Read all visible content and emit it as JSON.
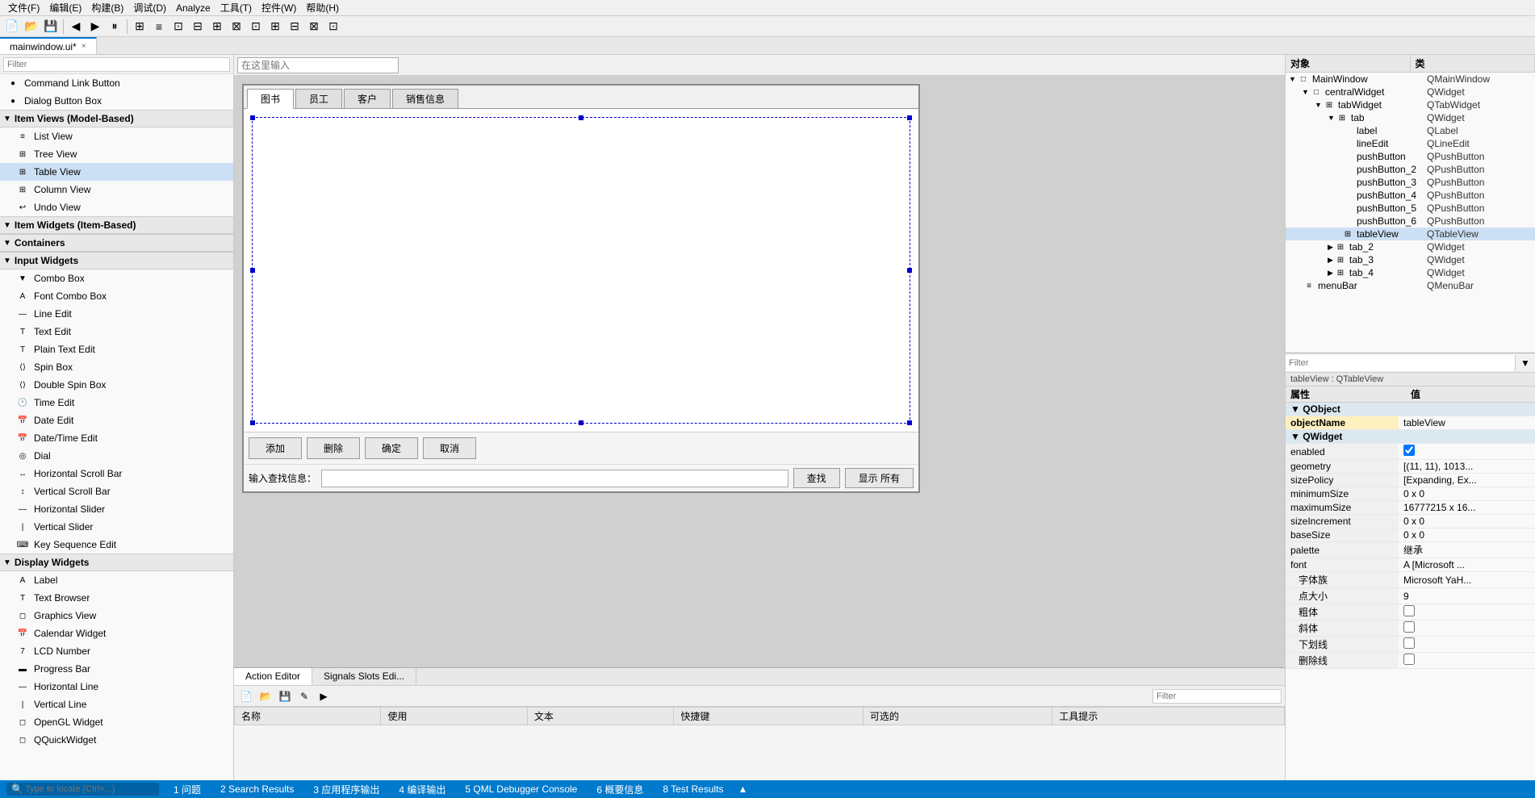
{
  "menubar": {
    "items": [
      "文件(F)",
      "编辑(E)",
      "构建(B)",
      "调试(D)",
      "Analyze",
      "工具(T)",
      "控件(W)",
      "帮助(H)"
    ]
  },
  "filetab": {
    "name": "mainwindow.ui*",
    "close": "×"
  },
  "sidebar": {
    "filter_placeholder": "Filter",
    "items": [
      {
        "id": "command-link-button",
        "label": "Command Link Button",
        "indent": 0,
        "icon": "●"
      },
      {
        "id": "dialog-button-box",
        "label": "Dialog Button Box",
        "indent": 0,
        "icon": "●"
      },
      {
        "id": "item-views-header",
        "label": "Item Views (Model-Based)",
        "indent": 0,
        "type": "category"
      },
      {
        "id": "list-view",
        "label": "List View",
        "indent": 1,
        "icon": "≡"
      },
      {
        "id": "tree-view",
        "label": "Tree View",
        "indent": 1,
        "icon": "⊞"
      },
      {
        "id": "table-view",
        "label": "Table View",
        "indent": 1,
        "icon": "⊞",
        "selected": true
      },
      {
        "id": "column-view",
        "label": "Column View",
        "indent": 1,
        "icon": "⊞"
      },
      {
        "id": "undo-view",
        "label": "Undo View",
        "indent": 1,
        "icon": "↩"
      },
      {
        "id": "item-widgets-header",
        "label": "Item Widgets (Item-Based)",
        "indent": 0,
        "type": "category"
      },
      {
        "id": "containers-header",
        "label": "Containers",
        "indent": 0,
        "type": "category"
      },
      {
        "id": "input-widgets-header",
        "label": "Input Widgets",
        "indent": 0,
        "type": "category"
      },
      {
        "id": "combo-box",
        "label": "Combo Box",
        "indent": 1,
        "icon": "▼"
      },
      {
        "id": "font-combo-box",
        "label": "Font Combo Box",
        "indent": 1,
        "icon": "A"
      },
      {
        "id": "line-edit",
        "label": "Line Edit",
        "indent": 1,
        "icon": "—"
      },
      {
        "id": "text-edit",
        "label": "Text Edit",
        "indent": 1,
        "icon": "T"
      },
      {
        "id": "plain-text-edit",
        "label": "Plain Text Edit",
        "indent": 1,
        "icon": "T"
      },
      {
        "id": "spin-box",
        "label": "Spin Box",
        "indent": 1,
        "icon": "⟨⟩"
      },
      {
        "id": "double-spin-box",
        "label": "Double Spin Box",
        "indent": 1,
        "icon": "⟨⟩"
      },
      {
        "id": "time-edit",
        "label": "Time Edit",
        "indent": 1,
        "icon": "🕐"
      },
      {
        "id": "date-edit",
        "label": "Date Edit",
        "indent": 1,
        "icon": "📅"
      },
      {
        "id": "datetime-edit",
        "label": "Date/Time Edit",
        "indent": 1,
        "icon": "📅"
      },
      {
        "id": "dial",
        "label": "Dial",
        "indent": 1,
        "icon": "◎"
      },
      {
        "id": "horizontal-scroll-bar",
        "label": "Horizontal Scroll Bar",
        "indent": 1,
        "icon": "↔"
      },
      {
        "id": "vertical-scroll-bar",
        "label": "Vertical Scroll Bar",
        "indent": 1,
        "icon": "↕"
      },
      {
        "id": "horizontal-slider",
        "label": "Horizontal Slider",
        "indent": 1,
        "icon": "—"
      },
      {
        "id": "vertical-slider",
        "label": "Vertical Slider",
        "indent": 1,
        "icon": "|"
      },
      {
        "id": "key-sequence-edit",
        "label": "Key Sequence Edit",
        "indent": 1,
        "icon": "⌨"
      },
      {
        "id": "display-widgets-header",
        "label": "Display Widgets",
        "indent": 0,
        "type": "category"
      },
      {
        "id": "label",
        "label": "Label",
        "indent": 1,
        "icon": "A"
      },
      {
        "id": "text-browser",
        "label": "Text Browser",
        "indent": 1,
        "icon": "T"
      },
      {
        "id": "graphics-view",
        "label": "Graphics View",
        "indent": 1,
        "icon": "◻"
      },
      {
        "id": "calendar-widget",
        "label": "Calendar Widget",
        "indent": 1,
        "icon": "📅"
      },
      {
        "id": "lcd-number",
        "label": "LCD Number",
        "indent": 1,
        "icon": "7"
      },
      {
        "id": "progress-bar",
        "label": "Progress Bar",
        "indent": 1,
        "icon": "▬"
      },
      {
        "id": "horizontal-line",
        "label": "Horizontal Line",
        "indent": 1,
        "icon": "—"
      },
      {
        "id": "vertical-line",
        "label": "Vertical Line",
        "indent": 1,
        "icon": "|"
      },
      {
        "id": "opengl-widget",
        "label": "OpenGL Widget",
        "indent": 1,
        "icon": "◻"
      },
      {
        "id": "qquickwidget",
        "label": "QQuickWidget",
        "indent": 1,
        "icon": "◻"
      }
    ]
  },
  "canvas": {
    "filter_placeholder": "在这里输入",
    "tabs": [
      "图书",
      "员工",
      "客户",
      "销售信息"
    ],
    "active_tab": 0,
    "buttons": [
      "添加",
      "删除",
      "确定",
      "取消"
    ],
    "search_label": "输入查找信息：",
    "search_placeholder": "",
    "search_btn": "查找",
    "show_all_btn": "显示 所有"
  },
  "bottom_panel": {
    "tabs": [
      "Action Editor",
      "Signals Slots Edi..."
    ],
    "active_tab": 0,
    "filter_placeholder": "Filter",
    "table": {
      "headers": [
        "名称",
        "使用",
        "文本",
        "快捷键",
        "可选的",
        "工具提示"
      ],
      "rows": []
    }
  },
  "right_panel": {
    "object_header": "对象",
    "class_header": "类",
    "tree": [
      {
        "level": 0,
        "arrow": "▼",
        "icon": "□",
        "name": "MainWindow",
        "type": "QMainWindow"
      },
      {
        "level": 1,
        "arrow": "▼",
        "icon": "□",
        "name": "centralWidget",
        "type": "QWidget"
      },
      {
        "level": 2,
        "arrow": "▼",
        "icon": "⊞",
        "name": "tabWidget",
        "type": "QTabWidget"
      },
      {
        "level": 3,
        "arrow": "▼",
        "icon": "⊞",
        "name": "tab",
        "type": "QWidget"
      },
      {
        "level": 4,
        "arrow": " ",
        "icon": " ",
        "name": "label",
        "type": "QLabel"
      },
      {
        "level": 4,
        "arrow": " ",
        "icon": " ",
        "name": "lineEdit",
        "type": "QLineEdit"
      },
      {
        "level": 4,
        "arrow": " ",
        "icon": " ",
        "name": "pushButton",
        "type": "QPushButton"
      },
      {
        "level": 4,
        "arrow": " ",
        "icon": " ",
        "name": "pushButton_2",
        "type": "QPushButton"
      },
      {
        "level": 4,
        "arrow": " ",
        "icon": " ",
        "name": "pushButton_3",
        "type": "QPushButton"
      },
      {
        "level": 4,
        "arrow": " ",
        "icon": " ",
        "name": "pushButton_4",
        "type": "QPushButton"
      },
      {
        "level": 4,
        "arrow": " ",
        "icon": " ",
        "name": "pushButton_5",
        "type": "QPushButton"
      },
      {
        "level": 4,
        "arrow": " ",
        "icon": " ",
        "name": "pushButton_6",
        "type": "QPushButton"
      },
      {
        "level": 4,
        "arrow": " ",
        "icon": "⊞",
        "name": "tableView",
        "type": "QTableView",
        "selected": true
      },
      {
        "level": 3,
        "arrow": "▶",
        "icon": "⊞",
        "name": "tab_2",
        "type": "QWidget"
      },
      {
        "level": 3,
        "arrow": "▶",
        "icon": "⊞",
        "name": "tab_3",
        "type": "QWidget"
      },
      {
        "level": 3,
        "arrow": "▶",
        "icon": "⊞",
        "name": "tab_4",
        "type": "QWidget"
      },
      {
        "level": 1,
        "arrow": " ",
        "icon": "≡",
        "name": "menuBar",
        "type": "QMenuBar"
      }
    ],
    "properties": {
      "filter_placeholder": "Filter",
      "current_object": "tableView : QTableView",
      "attribute_header": "属性",
      "value_header": "值",
      "sections": [
        {
          "name": "QObject",
          "rows": [
            {
              "name": "objectName",
              "value": "tableView",
              "highlighted": true
            }
          ]
        },
        {
          "name": "QWidget",
          "rows": [
            {
              "name": "enabled",
              "value": "✓",
              "type": "checkbox"
            },
            {
              "name": "geometry",
              "value": "[(11, 11), 1013..."
            },
            {
              "name": "sizePolicy",
              "value": "[Expanding, Ex..."
            },
            {
              "name": "minimumSize",
              "value": "0 x 0"
            },
            {
              "name": "maximumSize",
              "value": "16777215 x 16..."
            },
            {
              "name": "sizeIncrement",
              "value": "0 x 0"
            },
            {
              "name": "baseSize",
              "value": "0 x 0"
            },
            {
              "name": "palette",
              "value": "继承"
            },
            {
              "name": "font",
              "value": "A  [Microsoft ..."
            }
          ]
        },
        {
          "name": "font_sub",
          "rows": [
            {
              "name": "字体族",
              "value": "Microsoft YaH...",
              "indent": true
            },
            {
              "name": "点大小",
              "value": "9",
              "indent": true
            },
            {
              "name": "粗体",
              "value": "checkbox",
              "indent": true,
              "type": "checkbox_empty"
            },
            {
              "name": "斜体",
              "value": "checkbox",
              "indent": true,
              "type": "checkbox_empty"
            },
            {
              "name": "下划线",
              "value": "checkbox",
              "indent": true,
              "type": "checkbox_empty"
            },
            {
              "name": "删除线",
              "value": "checkbox",
              "indent": true,
              "type": "checkbox_empty"
            }
          ]
        }
      ]
    }
  },
  "statusbar": {
    "items": [
      "1 问题",
      "2 Search Results",
      "3 应用程序输出",
      "4 编译输出",
      "5 QML Debugger Console",
      "6 概要信息",
      "8 Test Results"
    ],
    "search_placeholder": "Type to locate (Ctrl+...)",
    "arrow": "▲"
  }
}
